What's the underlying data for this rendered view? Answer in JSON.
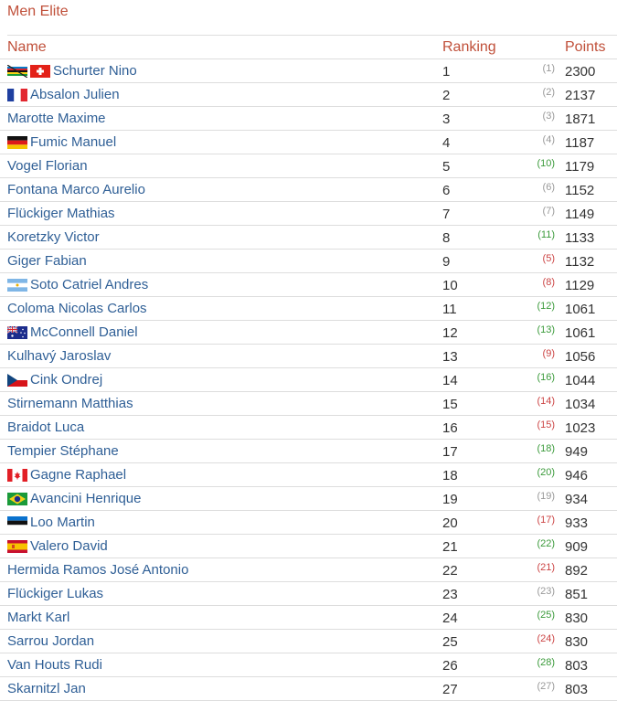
{
  "title": "Men Elite",
  "headers": {
    "name": "Name",
    "ranking": "Ranking",
    "points": "Points"
  },
  "rows": [
    {
      "flags": [
        "world-champion-flag",
        "switzerland-flag"
      ],
      "name": "Schurter Nino",
      "rank": "1",
      "prev": "(1)",
      "trend": "same",
      "points": "2300"
    },
    {
      "flags": [
        "france-flag"
      ],
      "name": "Absalon Julien",
      "rank": "2",
      "prev": "(2)",
      "trend": "same",
      "points": "2137"
    },
    {
      "flags": [],
      "name": "Marotte Maxime",
      "rank": "3",
      "prev": "(3)",
      "trend": "same",
      "points": "1871"
    },
    {
      "flags": [
        "germany-flag"
      ],
      "name": "Fumic Manuel",
      "rank": "4",
      "prev": "(4)",
      "trend": "same",
      "points": "1187"
    },
    {
      "flags": [],
      "name": "Vogel Florian",
      "rank": "5",
      "prev": "(10)",
      "trend": "up",
      "points": "1179"
    },
    {
      "flags": [],
      "name": "Fontana Marco Aurelio",
      "rank": "6",
      "prev": "(6)",
      "trend": "same",
      "points": "1152"
    },
    {
      "flags": [],
      "name": "Flückiger Mathias",
      "rank": "7",
      "prev": "(7)",
      "trend": "same",
      "points": "1149"
    },
    {
      "flags": [],
      "name": "Koretzky Victor",
      "rank": "8",
      "prev": "(11)",
      "trend": "up",
      "points": "1133"
    },
    {
      "flags": [],
      "name": "Giger Fabian",
      "rank": "9",
      "prev": "(5)",
      "trend": "down",
      "points": "1132"
    },
    {
      "flags": [
        "argentina-flag"
      ],
      "name": "Soto Catriel Andres",
      "rank": "10",
      "prev": "(8)",
      "trend": "down",
      "points": "1129"
    },
    {
      "flags": [],
      "name": "Coloma Nicolas Carlos",
      "rank": "11",
      "prev": "(12)",
      "trend": "up",
      "points": "1061"
    },
    {
      "flags": [
        "australia-flag"
      ],
      "name": "McConnell Daniel",
      "rank": "12",
      "prev": "(13)",
      "trend": "up",
      "points": "1061"
    },
    {
      "flags": [],
      "name": "Kulhavý Jaroslav",
      "rank": "13",
      "prev": "(9)",
      "trend": "down",
      "points": "1056"
    },
    {
      "flags": [
        "czech-flag"
      ],
      "name": "Cink Ondrej",
      "rank": "14",
      "prev": "(16)",
      "trend": "up",
      "points": "1044"
    },
    {
      "flags": [],
      "name": "Stirnemann Matthias",
      "rank": "15",
      "prev": "(14)",
      "trend": "down",
      "points": "1034"
    },
    {
      "flags": [],
      "name": "Braidot Luca",
      "rank": "16",
      "prev": "(15)",
      "trend": "down",
      "points": "1023"
    },
    {
      "flags": [],
      "name": "Tempier Stéphane",
      "rank": "17",
      "prev": "(18)",
      "trend": "up",
      "points": "949"
    },
    {
      "flags": [
        "canada-flag"
      ],
      "name": "Gagne Raphael",
      "rank": "18",
      "prev": "(20)",
      "trend": "up",
      "points": "946"
    },
    {
      "flags": [
        "brazil-flag"
      ],
      "name": "Avancini Henrique",
      "rank": "19",
      "prev": "(19)",
      "trend": "same",
      "points": "934"
    },
    {
      "flags": [
        "estonia-flag"
      ],
      "name": "Loo Martin",
      "rank": "20",
      "prev": "(17)",
      "trend": "down",
      "points": "933"
    },
    {
      "flags": [
        "spain-flag"
      ],
      "name": "Valero David",
      "rank": "21",
      "prev": "(22)",
      "trend": "up",
      "points": "909"
    },
    {
      "flags": [],
      "name": "Hermida Ramos José Antonio",
      "rank": "22",
      "prev": "(21)",
      "trend": "down",
      "points": "892"
    },
    {
      "flags": [],
      "name": "Flückiger Lukas",
      "rank": "23",
      "prev": "(23)",
      "trend": "same",
      "points": "851"
    },
    {
      "flags": [],
      "name": "Markt Karl",
      "rank": "24",
      "prev": "(25)",
      "trend": "up",
      "points": "830"
    },
    {
      "flags": [],
      "name": "Sarrou Jordan",
      "rank": "25",
      "prev": "(24)",
      "trend": "down",
      "points": "830"
    },
    {
      "flags": [],
      "name": "Van Houts Rudi",
      "rank": "26",
      "prev": "(28)",
      "trend": "up",
      "points": "803"
    },
    {
      "flags": [],
      "name": "Skarnitzl Jan",
      "rank": "27",
      "prev": "(27)",
      "trend": "same",
      "points": "803"
    }
  ],
  "colors": {
    "header_text": "#c0503a",
    "name_link": "#2f5f96",
    "trend_up": "#3a9a3a",
    "trend_down": "#cc4444",
    "trend_same": "#999999"
  }
}
